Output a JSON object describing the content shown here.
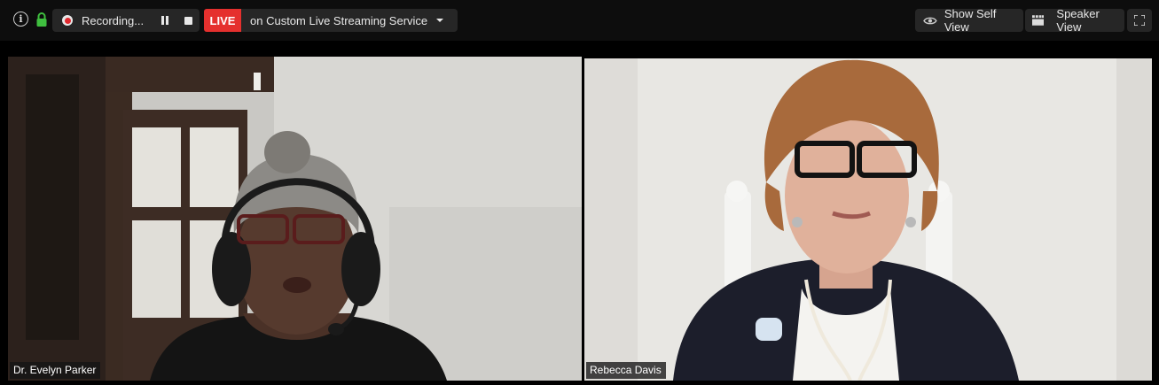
{
  "toolbar": {
    "info_icon": "info-icon",
    "lock_icon": "lock-icon",
    "recording_label": "Recording...",
    "live_badge": "LIVE",
    "streaming_label": "on Custom Live Streaming Service",
    "show_self_view_label": "Show Self View",
    "speaker_view_label": "Speaker View",
    "fullscreen_icon": "fullscreen-icon"
  },
  "participants": [
    {
      "name": "Dr. Evelyn Parker",
      "active_speaker": true
    },
    {
      "name": "Rebecca Davis",
      "active_speaker": false
    }
  ],
  "colors": {
    "live_red": "#e5302e",
    "record_red": "#e0292f",
    "active_border": "#d9e56a",
    "lock_green": "#3fbf3f"
  }
}
